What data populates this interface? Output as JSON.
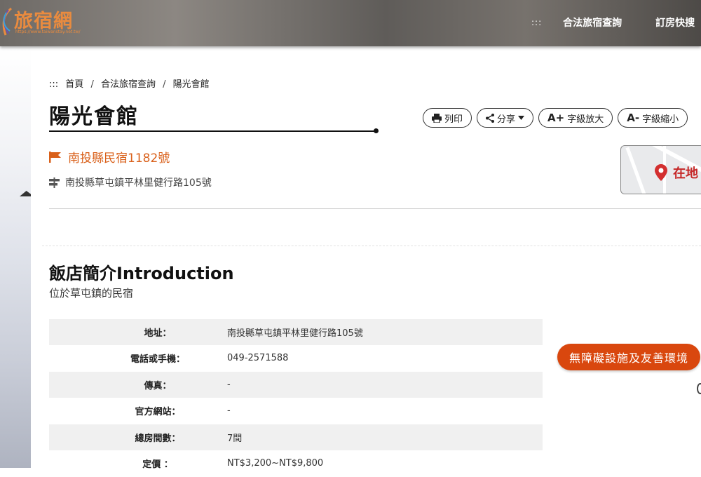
{
  "header": {
    "logo_text": "旅宿網",
    "logo_url": "https://www.taiwanstay.net.tw/",
    "nav_dots": ":::",
    "nav_items": [
      "合法旅宿查詢",
      "訂房快搜"
    ]
  },
  "breadcrumb": {
    "marker": ":::",
    "items": [
      "首頁",
      "合法旅宿查詢",
      "陽光會館"
    ],
    "separator": "/"
  },
  "page_title": "陽光會館",
  "toolbar": {
    "print_label": "列印",
    "share_label": "分享",
    "font_up_label": "字級放大",
    "font_up_prefix": "A+",
    "font_down_label": "字級縮小",
    "font_down_prefix": "A-"
  },
  "license": "南投縣民宿1182號",
  "address": "南投縣草屯鎮平林里健行路105號",
  "map": {
    "label": "在地"
  },
  "intro": {
    "title": "飯店簡介Introduction",
    "subtitle": "位於草屯鎮的民宿",
    "rows": [
      {
        "label": "地址：",
        "value": "南投縣草屯鎮平林里健行路105號"
      },
      {
        "label": "電話或手機：",
        "value": "049-2571588"
      },
      {
        "label": "傳真：",
        "value": "-"
      },
      {
        "label": "官方網站：",
        "value": "-"
      },
      {
        "label": "總房間數：",
        "value": "7間"
      },
      {
        "label": "定價 ：",
        "value": "NT$3,200~NT$9,800"
      }
    ]
  },
  "accessible_button": "無障礙設施及友善環境",
  "colors": {
    "accent": "#d9601a",
    "button": "#d9470e",
    "logo": "#e98b3f"
  }
}
